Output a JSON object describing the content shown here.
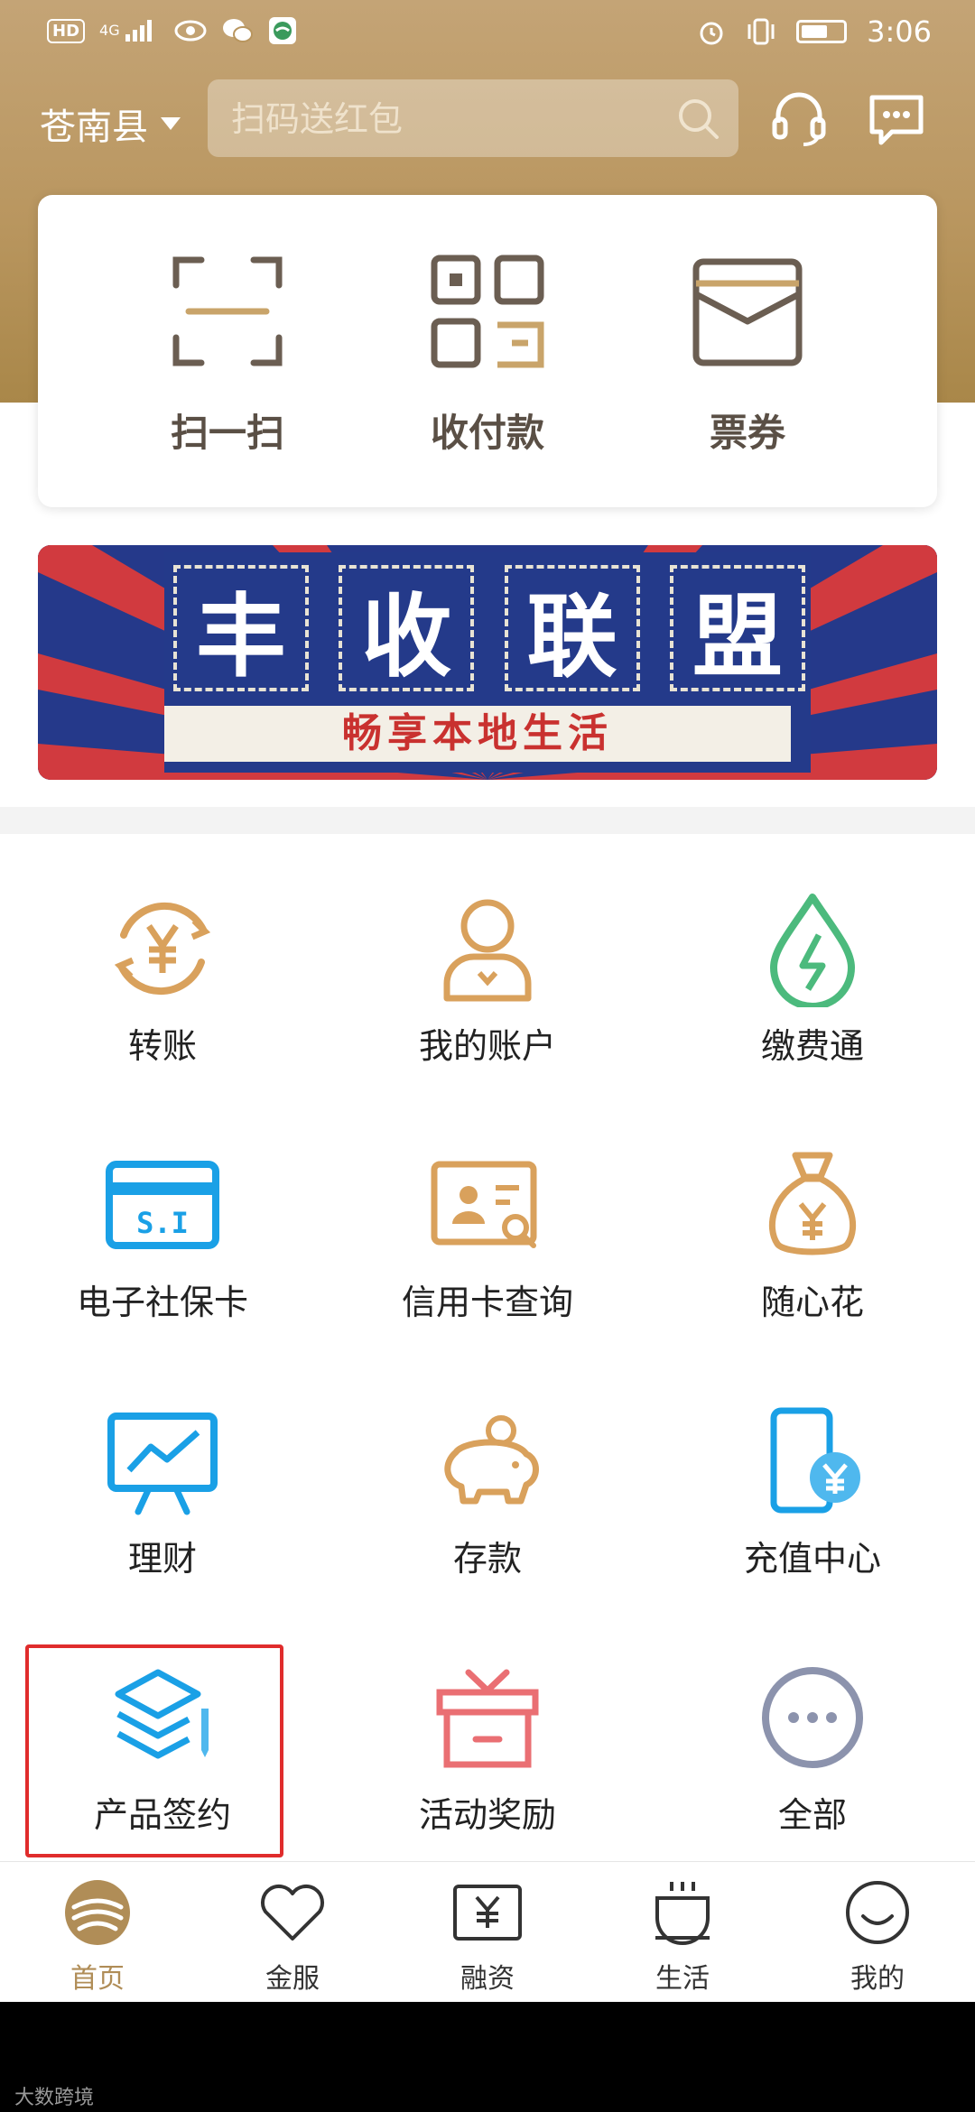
{
  "status_bar": {
    "network": "4G",
    "hd": "HD",
    "time": "3:06"
  },
  "header": {
    "location": "苍南县",
    "search_placeholder": "扫码送红包",
    "colors": {
      "gold": "#b9965f"
    }
  },
  "quick_actions": [
    {
      "label": "扫一扫",
      "icon": "scan-icon"
    },
    {
      "label": "收付款",
      "icon": "qr-code-icon"
    },
    {
      "label": "票券",
      "icon": "coupon-icon"
    }
  ],
  "banner": {
    "title_chars": [
      "丰",
      "收",
      "联",
      "盟"
    ],
    "subtitle": "畅享本地生活"
  },
  "grid": [
    {
      "label": "转账",
      "icon": "transfer-icon"
    },
    {
      "label": "我的账户",
      "icon": "account-icon"
    },
    {
      "label": "缴费通",
      "icon": "payment-drop-icon"
    },
    {
      "label": "电子社保卡",
      "icon": "social-security-card-icon"
    },
    {
      "label": "信用卡查询",
      "icon": "credit-card-query-icon"
    },
    {
      "label": "随心花",
      "icon": "money-bag-icon"
    },
    {
      "label": "理财",
      "icon": "finance-chart-icon"
    },
    {
      "label": "存款",
      "icon": "piggy-bank-icon"
    },
    {
      "label": "充值中心",
      "icon": "phone-recharge-icon"
    },
    {
      "label": "产品签约",
      "icon": "product-layers-icon"
    },
    {
      "label": "活动奖励",
      "icon": "gift-box-icon"
    },
    {
      "label": "全部",
      "icon": "more-icon"
    }
  ],
  "tabs": [
    {
      "label": "首页",
      "icon": "home-logo-icon",
      "active": true
    },
    {
      "label": "金服",
      "icon": "heart-icon"
    },
    {
      "label": "融资",
      "icon": "yuan-box-icon"
    },
    {
      "label": "生活",
      "icon": "cup-icon"
    },
    {
      "label": "我的",
      "icon": "smile-icon"
    }
  ],
  "watermark": "大数跨境"
}
